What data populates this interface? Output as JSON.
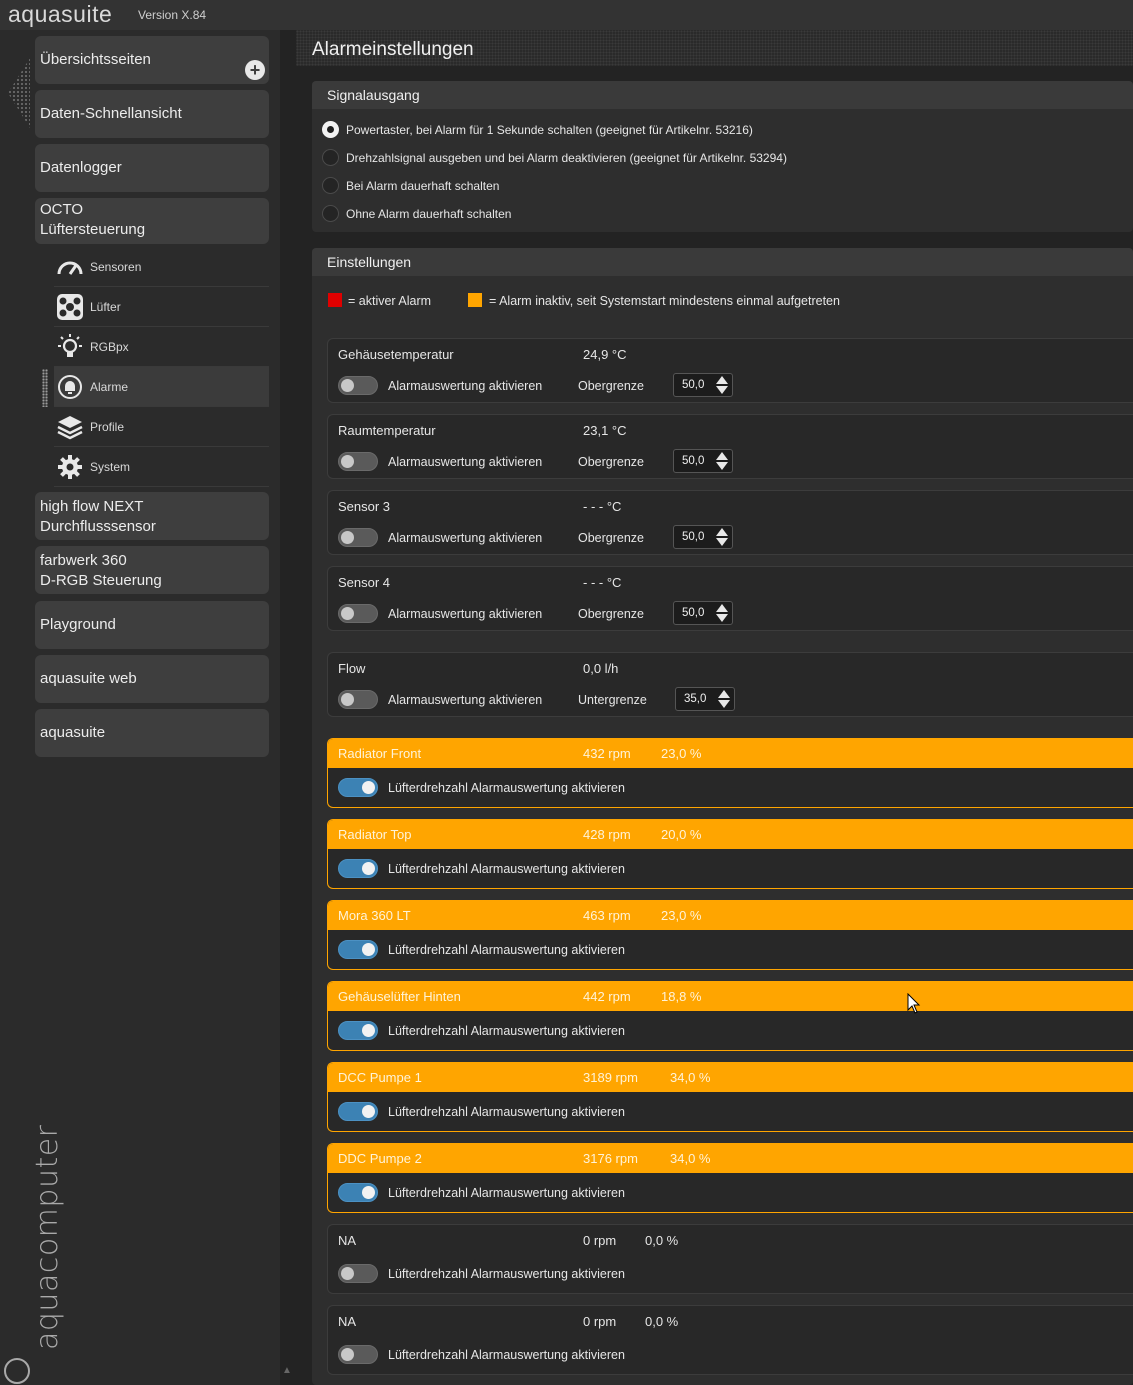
{
  "app": {
    "title": "aquasuite",
    "version": "Version X.84"
  },
  "sidebar": {
    "overview": "Übersichtsseiten",
    "quickview": "Daten-Schnellansicht",
    "datalogger": "Datenlogger",
    "octo_line1": "OCTO",
    "octo_line2": "Lüftersteuerung",
    "sub": {
      "sensoren": "Sensoren",
      "luefter": "Lüfter",
      "rgbpx": "RGBpx",
      "alarme": "Alarme",
      "profile": "Profile",
      "system": "System"
    },
    "highflow_line1": "high flow NEXT",
    "highflow_line2": "Durchflusssensor",
    "farbwerk_line1": "farbwerk 360",
    "farbwerk_line2": "D-RGB Steuerung",
    "playground": "Playground",
    "web": "aquasuite web",
    "aquasuite": "aquasuite",
    "brand": "aquacomputer"
  },
  "page": {
    "title": "Alarmeinstellungen"
  },
  "signal": {
    "title": "Signalausgang",
    "options": [
      "Powertaster, bei Alarm für 1 Sekunde schalten (geeignet für Artikelnr. 53216)",
      "Drehzahlsignal ausgeben und bei Alarm deaktivieren (geeignet für Artikelnr. 53294)",
      "Bei Alarm dauerhaft schalten",
      "Ohne Alarm dauerhaft schalten"
    ],
    "selected_index": 0
  },
  "settings": {
    "title": "Einstellungen",
    "legend_active": "= aktiver Alarm",
    "legend_inactive": "= Alarm inaktiv, seit Systemstart mindestens einmal aufgetreten",
    "color_active": "#e00000",
    "color_inactive": "#ffa500",
    "toggle_label": "Alarmauswertung aktivieren",
    "fan_toggle_label": "Lüfterdrehzahl Alarmauswertung aktivieren",
    "sensors": [
      {
        "name": "Gehäusetemperatur",
        "value": "24,9 °C",
        "limit_label": "Obergrenze",
        "limit": "50,0",
        "enabled": false
      },
      {
        "name": "Raumtemperatur",
        "value": "23,1 °C",
        "limit_label": "Obergrenze",
        "limit": "50,0",
        "enabled": false
      },
      {
        "name": "Sensor 3",
        "value": "- - - °C",
        "limit_label": "Obergrenze",
        "limit": "50,0",
        "enabled": false
      },
      {
        "name": "Sensor 4",
        "value": "- - - °C",
        "limit_label": "Obergrenze",
        "limit": "50,0",
        "enabled": false
      },
      {
        "name": "Flow",
        "value": "0,0 l/h",
        "limit_label": "Untergrenze",
        "limit": "35,0",
        "enabled": false
      }
    ],
    "fans": [
      {
        "name": "Radiator Front",
        "rpm": "432 rpm",
        "pct": "23,0 %",
        "enabled": true,
        "alarm_seen": true
      },
      {
        "name": "Radiator Top",
        "rpm": "428 rpm",
        "pct": "20,0 %",
        "enabled": true,
        "alarm_seen": true
      },
      {
        "name": "Mora 360 LT",
        "rpm": "463 rpm",
        "pct": "23,0 %",
        "enabled": true,
        "alarm_seen": true
      },
      {
        "name": "Gehäuselüfter Hinten",
        "rpm": "442 rpm",
        "pct": "18,8 %",
        "enabled": true,
        "alarm_seen": true
      },
      {
        "name": "DCC Pumpe 1",
        "rpm": "3189 rpm",
        "pct": "34,0 %",
        "enabled": true,
        "alarm_seen": true
      },
      {
        "name": "DDC Pumpe 2",
        "rpm": "3176 rpm",
        "pct": "34,0 %",
        "enabled": true,
        "alarm_seen": true
      },
      {
        "name": "NA",
        "rpm": "0 rpm",
        "pct": "0,0 %",
        "enabled": false,
        "alarm_seen": false
      },
      {
        "name": "NA",
        "rpm": "0 rpm",
        "pct": "0,0 %",
        "enabled": false,
        "alarm_seen": false
      }
    ]
  },
  "icons": [
    "plus-icon",
    "gauge-icon",
    "fan-icon",
    "bulb-icon",
    "alarm-icon",
    "layers-icon",
    "gear-icon",
    "mouse-cursor-icon"
  ]
}
